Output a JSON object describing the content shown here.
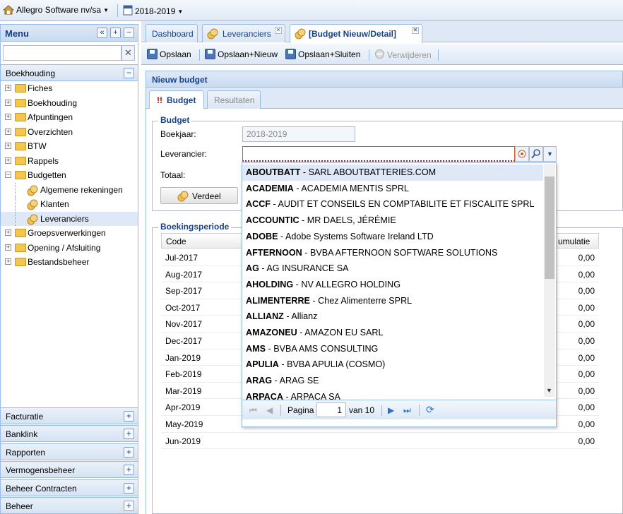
{
  "topbar": {
    "company": "Allegro Software nv/sa",
    "year": "2018-2019"
  },
  "menu": {
    "title": "Menu",
    "section": "Boekhouding",
    "tree": [
      {
        "label": "Fiches",
        "level": 0,
        "type": "folder",
        "exp": "+"
      },
      {
        "label": "Boekhouding",
        "level": 0,
        "type": "folder",
        "exp": "+"
      },
      {
        "label": "Afpuntingen",
        "level": 0,
        "type": "folder",
        "exp": "+"
      },
      {
        "label": "Overzichten",
        "level": 0,
        "type": "folder",
        "exp": "+"
      },
      {
        "label": "BTW",
        "level": 0,
        "type": "folder",
        "exp": "+"
      },
      {
        "label": "Rappels",
        "level": 0,
        "type": "folder",
        "exp": "+"
      },
      {
        "label": "Budgetten",
        "level": 0,
        "type": "folder",
        "exp": "−"
      },
      {
        "label": "Algemene rekeningen",
        "level": 1,
        "type": "leaf"
      },
      {
        "label": "Klanten",
        "level": 1,
        "type": "leaf"
      },
      {
        "label": "Leveranciers",
        "level": 1,
        "type": "leaf",
        "selected": true
      },
      {
        "label": "Groepsverwerkingen",
        "level": 0,
        "type": "folder",
        "exp": "+"
      },
      {
        "label": "Opening / Afsluiting",
        "level": 0,
        "type": "folder",
        "exp": "+"
      },
      {
        "label": "Bestandsbeheer",
        "level": 0,
        "type": "folder",
        "exp": "+"
      }
    ],
    "bottom_sections": [
      "Facturatie",
      "Banklink",
      "Rapporten",
      "Vermogensbeheer",
      "Beheer Contracten",
      "Beheer"
    ]
  },
  "tabs": {
    "dashboard": "Dashboard",
    "leveranciers": "Leveranciers",
    "budget": "[Budget Nieuw/Detail]"
  },
  "toolbar": {
    "save": "Opslaan",
    "save_new": "Opslaan+Nieuw",
    "save_close": "Opslaan+Sluiten",
    "delete": "Verwijderen"
  },
  "panel": {
    "title": "Nieuw budget",
    "tab_budget": "Budget",
    "tab_results": "Resultaten",
    "tab_marker": "!!"
  },
  "form": {
    "legend": "Budget",
    "boekjaar_label": "Boekjaar:",
    "boekjaar_value": "2018-2019",
    "leverancier_label": "Leverancier:",
    "totaal_label": "Totaal:",
    "verdeel": "Verdeel"
  },
  "grid": {
    "legend": "Boekingsperiode",
    "col_code": "Code",
    "col_cum": "umulatie",
    "rows": [
      {
        "code": "Jul-2017",
        "value": "0,00"
      },
      {
        "code": "Aug-2017",
        "value": "0,00"
      },
      {
        "code": "Sep-2017",
        "value": "0,00"
      },
      {
        "code": "Oct-2017",
        "value": "0,00"
      },
      {
        "code": "Nov-2017",
        "value": "0,00"
      },
      {
        "code": "Dec-2017",
        "value": "0,00"
      },
      {
        "code": "Jan-2019",
        "value": "0,00"
      },
      {
        "code": "Feb-2019",
        "value": "0,00"
      },
      {
        "code": "Mar-2019",
        "value": "0,00"
      },
      {
        "code": "Apr-2019",
        "value": "0,00"
      },
      {
        "code": "May-2019",
        "value": "0,00"
      },
      {
        "code": "Jun-2019",
        "value": "0,00"
      }
    ]
  },
  "dropdown": {
    "items": [
      {
        "code": "ABOUTBATT",
        "name": "SARL ABOUTBATTERIES.COM"
      },
      {
        "code": "ACADEMIA",
        "name": "ACADEMIA MENTIS SPRL"
      },
      {
        "code": "ACCF",
        "name": "AUDIT ET CONSEILS EN COMPTABILITE ET FISCALITE SPRL"
      },
      {
        "code": "ACCOUNTIC",
        "name": "MR DAELS, JÉRÉMIE"
      },
      {
        "code": "ADOBE",
        "name": "Adobe Systems Software Ireland LTD"
      },
      {
        "code": "AFTERNOON",
        "name": "BVBA AFTERNOON SOFTWARE SOLUTIONS"
      },
      {
        "code": "AG",
        "name": "AG INSURANCE SA"
      },
      {
        "code": "AHOLDING",
        "name": "NV ALLEGRO HOLDING"
      },
      {
        "code": "ALIMENTERRE",
        "name": "Chez Alimenterre SPRL"
      },
      {
        "code": "ALLIANZ",
        "name": "Allianz"
      },
      {
        "code": "AMAZONEU",
        "name": "AMAZON EU SARL"
      },
      {
        "code": "AMS",
        "name": "BVBA AMS CONSULTING"
      },
      {
        "code": "APULIA",
        "name": "BVBA APULIA (COSMO)"
      },
      {
        "code": "ARAG",
        "name": "ARAG SE"
      },
      {
        "code": "ARPACA",
        "name": "ARPACA SA"
      }
    ],
    "separator": " - ",
    "pager": {
      "label": "Pagina",
      "page": "1",
      "of": "van 10"
    }
  }
}
